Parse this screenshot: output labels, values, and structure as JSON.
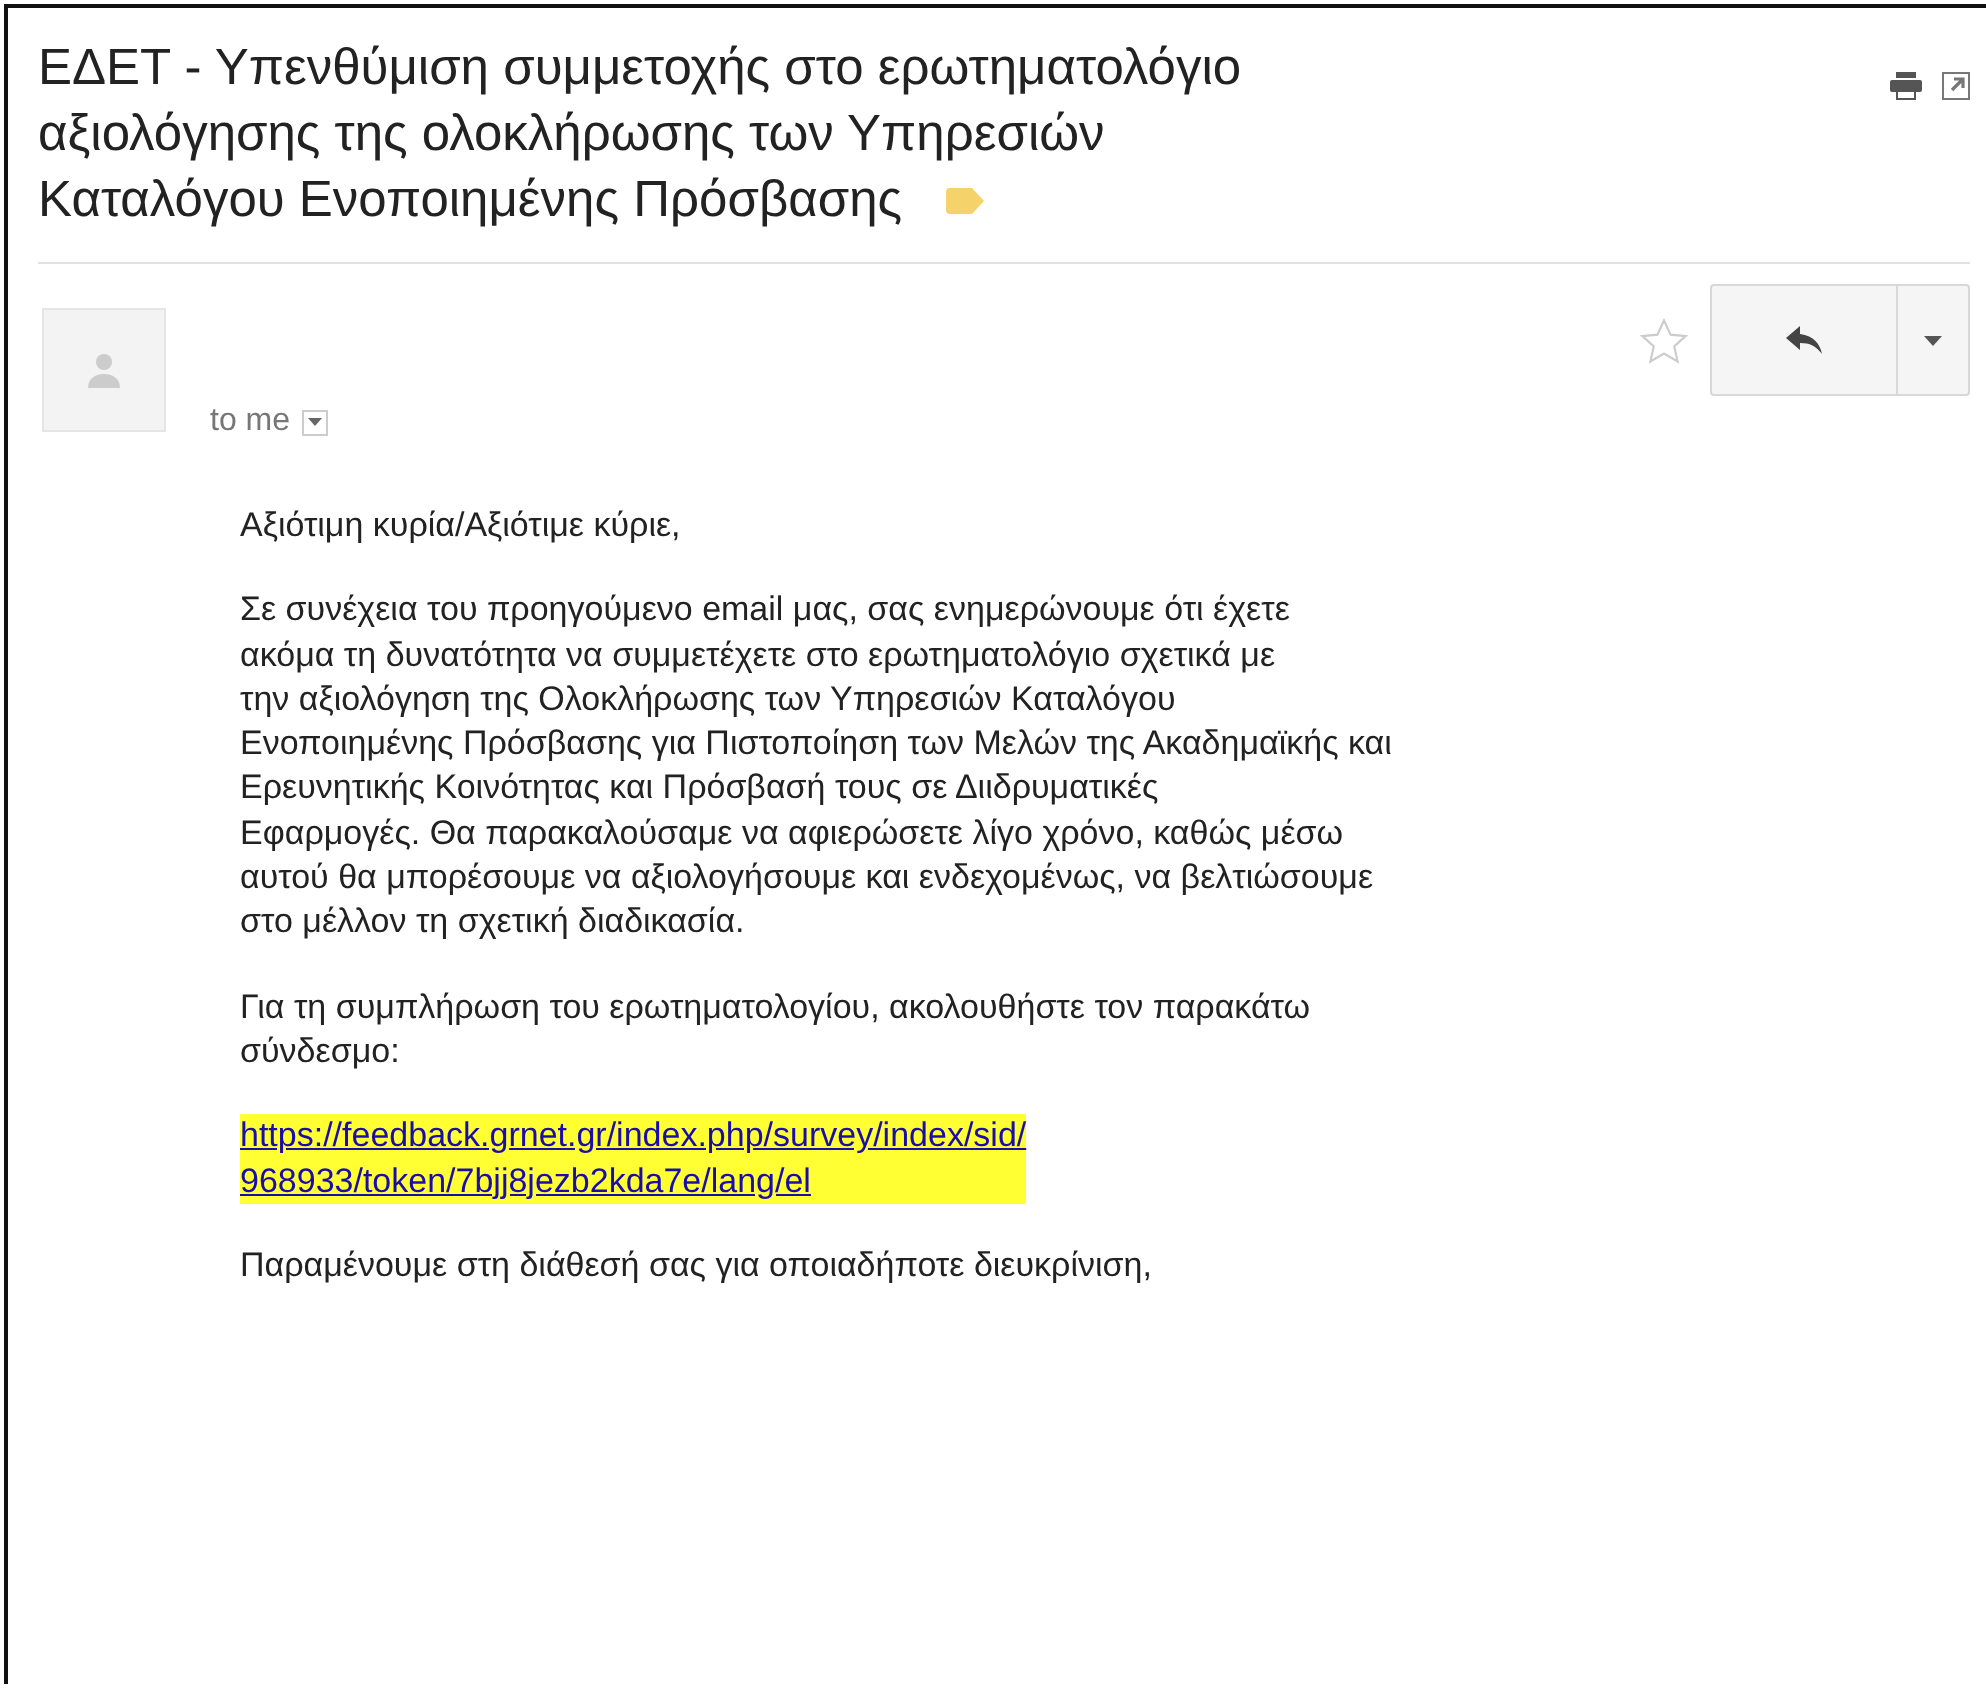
{
  "subject": {
    "title": "ΕΔΕΤ - Υπενθύμιση συμμετοχής στο ερωτηματολόγιο\nαξιολόγησης της ολοκλήρωσης των Υπηρεσιών\nΚαταλόγου Ενοποιημένης Πρόσβασης",
    "label": {
      "color": "#f6d36a"
    }
  },
  "message": {
    "recipient": "to me",
    "starred": false,
    "body": [
      {
        "kind": "text",
        "text": "Αξιότιμη κυρία/Αξιότιμε κύριε,"
      },
      {
        "kind": "text",
        "text": "Σε συνέχεια του προηγούμενο email μας, σας ενημερώνουμε ότι έχετε\nακόμα τη δυνατότητα να συμμετέχετε στο ερωτηματολόγιο σχετικά με\nτην αξιολόγηση της Ολοκλήρωσης των Υπηρεσιών Καταλόγου\nΕνοποιημένης Πρόσβασης για Πιστοποίηση των Μελών της Ακαδημαϊκής και\nΕρευνητικής Κοινότητας και Πρόσβασή τους σε Διιδρυματικές\nΕφαρμογές. Θα παρακαλούσαμε να αφιερώσετε λίγο χρόνο, καθώς μέσω\nαυτού θα μπορέσουμε να αξιολογήσουμε και ενδεχομένως, να βελτιώσουμε\nστο μέλλον τη σχετική διαδικασία."
      },
      {
        "kind": "text",
        "text": "Για τη συμπλήρωση του ερωτηματολογίου, ακολουθήστε τον παρακάτω\nσύνδεσμο:"
      },
      {
        "kind": "link",
        "text": "https://feedback.grnet.gr/index.php/survey/index/sid/\n968933/token/7bjj8jezb2kda7e/lang/el"
      },
      {
        "kind": "text",
        "text": "Παραμένουμε στη διάθεσή σας για οποιαδήποτε διευκρίνιση,"
      }
    ]
  }
}
